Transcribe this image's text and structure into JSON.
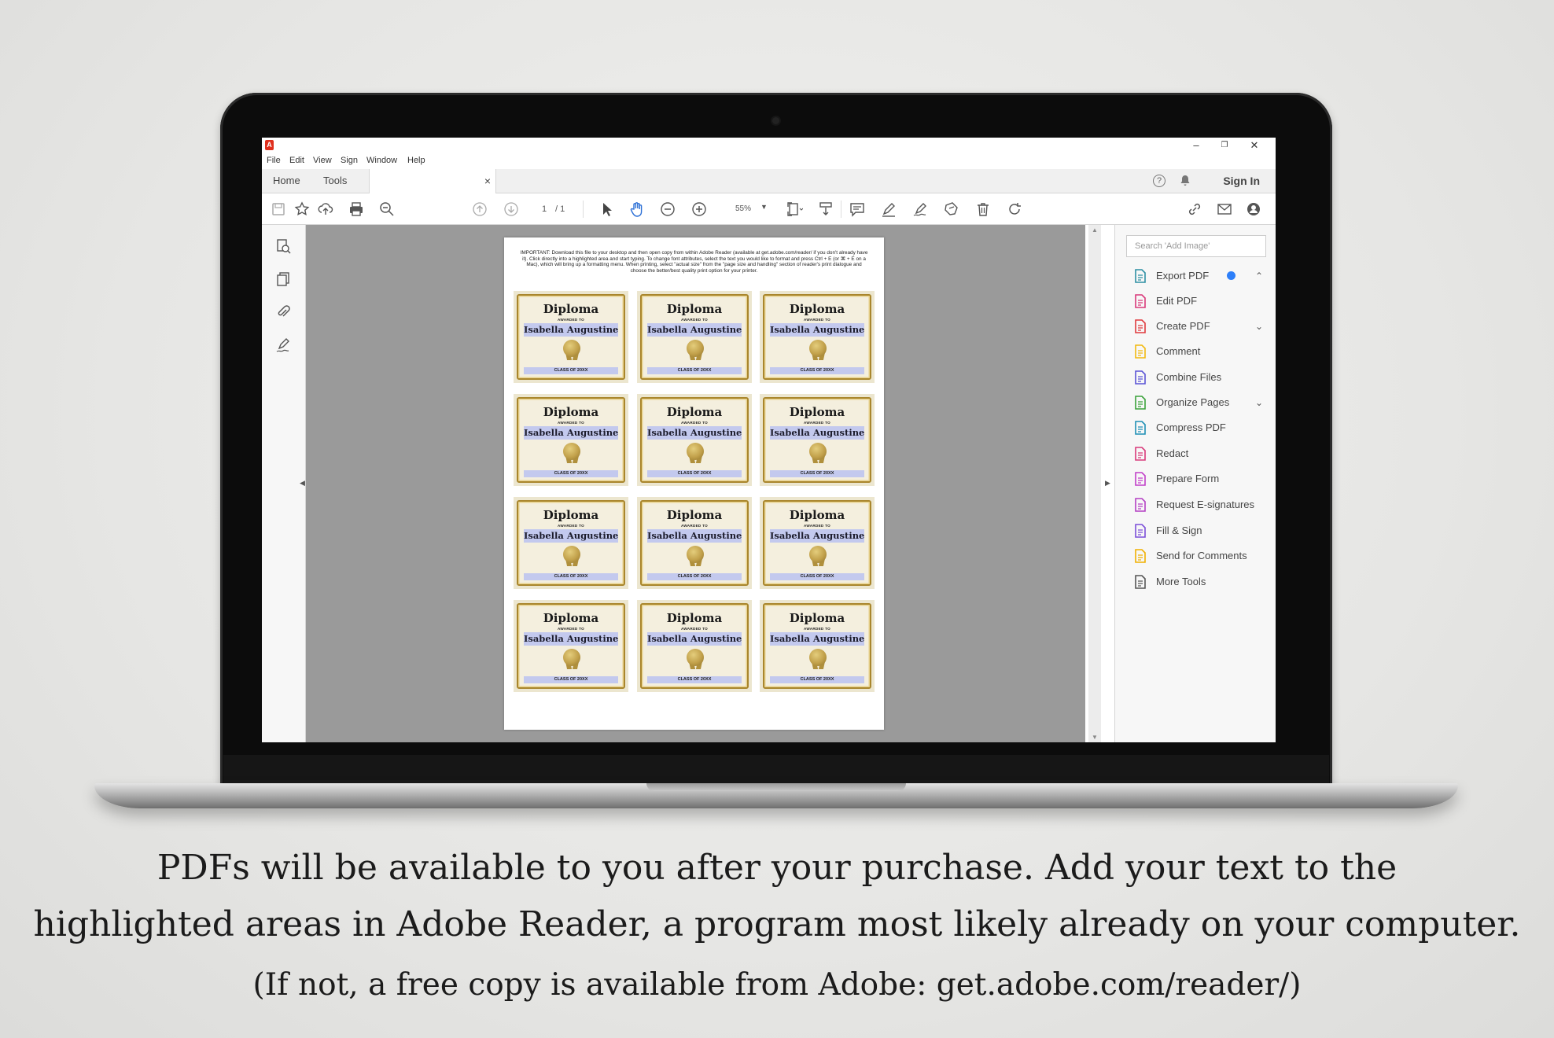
{
  "window": {
    "menu": [
      "File",
      "Edit",
      "View",
      "Sign",
      "Window",
      "Help"
    ],
    "tabs": {
      "home": "Home",
      "tools": "Tools"
    },
    "doc_tab_close": "×",
    "sign_in": "Sign In",
    "minimize": "–",
    "restore": "❐",
    "close": "✕"
  },
  "toolbar": {
    "page_current": "1",
    "page_total": "/ 1",
    "zoom": "55%",
    "icons": [
      "save-icon",
      "bookmark-star-icon",
      "upload-icon",
      "print-icon",
      "zoom-search-icon",
      "page-up-icon",
      "page-down-icon",
      "select-arrow-icon",
      "hand-icon",
      "zoom-out-icon",
      "zoom-in-icon",
      "fit-page-icon",
      "scroll-mode-icon",
      "comment-icon",
      "highlight-pen-icon",
      "draw-icon",
      "stamp-icon",
      "delete-icon",
      "rotate-icon",
      "link-icon",
      "email-icon",
      "account-icon"
    ]
  },
  "document": {
    "important_note": "IMPORTANT: Download this file to your desktop and then open copy from within Adobe Reader (available at get.adobe.com/reader/ if you don't already have it). Click directly into a highlighted area and start typing. To change font attributes, select the text you would like to format and press Ctrl + E (or ⌘ + E on a Mac), which will bring up a formatting menu. When printing, select \"actual size\" from the \"page size and handling\" section of reader's print dialogue and choose the better/best quality print option for your printer.",
    "certificate": {
      "title": "Diploma",
      "awarded_to": "AWARDED TO",
      "name": "Isabella Augustine",
      "class_of": "CLASS OF 20XX"
    },
    "certificate_count": 12
  },
  "right_pane": {
    "search_placeholder": "Search 'Add Image'",
    "tools": [
      {
        "label": "Export PDF",
        "chevron": "⌃",
        "color": "#2d8fa3"
      },
      {
        "label": "Edit PDF",
        "chevron": "",
        "color": "#d9387a"
      },
      {
        "label": "Create PDF",
        "chevron": "⌄",
        "color": "#e03a3e"
      },
      {
        "label": "Comment",
        "chevron": "",
        "color": "#f2b90f"
      },
      {
        "label": "Combine Files",
        "chevron": "",
        "color": "#5a54d6"
      },
      {
        "label": "Organize Pages",
        "chevron": "⌄",
        "color": "#3aa23a"
      },
      {
        "label": "Compress PDF",
        "chevron": "",
        "color": "#1e8fb5"
      },
      {
        "label": "Redact",
        "chevron": "",
        "color": "#d9387a"
      },
      {
        "label": "Prepare Form",
        "chevron": "",
        "color": "#c13ec8"
      },
      {
        "label": "Request E-signatures",
        "chevron": "",
        "color": "#b43fc4"
      },
      {
        "label": "Fill & Sign",
        "chevron": "",
        "color": "#7b4fd8"
      },
      {
        "label": "Send for Comments",
        "chevron": "",
        "color": "#f0b000"
      },
      {
        "label": "More Tools",
        "chevron": "",
        "color": "#555555"
      }
    ]
  },
  "caption": {
    "line1": "PDFs will be available to you after your purchase.  Add your text to the",
    "line2": "highlighted areas in Adobe Reader, a program most likely already on your computer.",
    "line3": "(If not, a free copy is available from Adobe: get.adobe.com/reader/)"
  }
}
